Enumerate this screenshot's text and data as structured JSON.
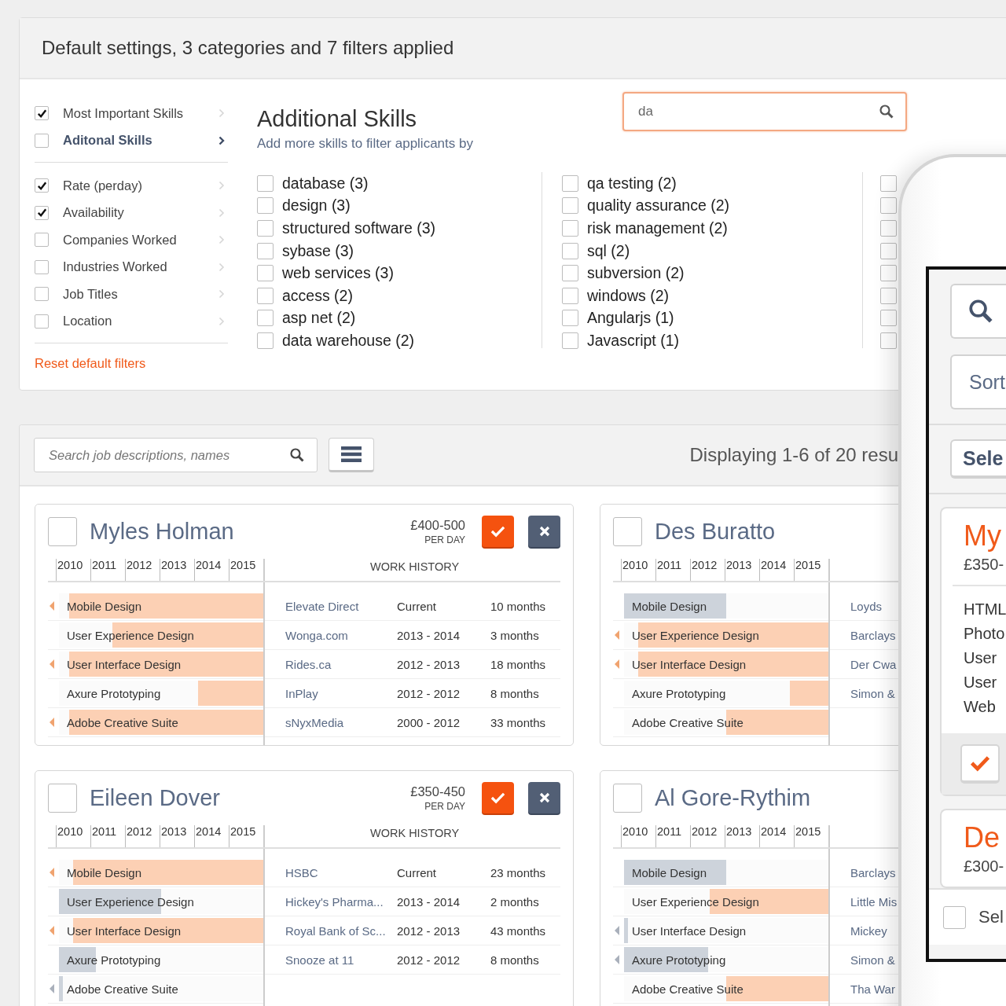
{
  "header": {
    "title": "Default settings, 3 categories and 7 filters applied"
  },
  "filters": {
    "groups": [
      [
        {
          "label": "Most Important Skills",
          "checked": true,
          "selected": false
        },
        {
          "label": "Aditonal Skills",
          "checked": false,
          "selected": true
        }
      ],
      [
        {
          "label": "Rate (perday)",
          "checked": true,
          "selected": false
        },
        {
          "label": "Availability",
          "checked": true,
          "selected": false
        },
        {
          "label": "Companies Worked",
          "checked": false,
          "selected": false
        },
        {
          "label": "Industries Worked",
          "checked": false,
          "selected": false
        },
        {
          "label": "Job Titles",
          "checked": false,
          "selected": false
        },
        {
          "label": "Location",
          "checked": false,
          "selected": false
        }
      ]
    ],
    "reset": "Reset default filters"
  },
  "additional_skills": {
    "title": "Additional Skills",
    "subtitle": "Add more skills to filter applicants by",
    "search": {
      "value": "da"
    },
    "columns": [
      [
        {
          "label": "database (3)",
          "checked": false
        },
        {
          "label": "design (3)",
          "checked": false
        },
        {
          "label": "structured software (3)",
          "checked": false
        },
        {
          "label": "sybase (3)",
          "checked": false
        },
        {
          "label": "web services (3)",
          "checked": false
        },
        {
          "label": "access (2)",
          "checked": false
        },
        {
          "label": "asp net (2)",
          "checked": false
        },
        {
          "label": "data warehouse (2)",
          "checked": false
        }
      ],
      [
        {
          "label": "qa testing (2)",
          "checked": false
        },
        {
          "label": "quality assurance (2)",
          "checked": false
        },
        {
          "label": "risk management (2)",
          "checked": false
        },
        {
          "label": "sql (2)",
          "checked": false
        },
        {
          "label": "subversion (2)",
          "checked": false
        },
        {
          "label": "windows (2)",
          "checked": false
        },
        {
          "label": "Angularjs (1)",
          "checked": false
        },
        {
          "label": "Javascript (1)",
          "checked": false
        }
      ],
      [
        {
          "checked": false
        },
        {
          "checked": false
        },
        {
          "checked": false
        },
        {
          "checked": false
        },
        {
          "checked": false
        },
        {
          "checked": false
        },
        {
          "checked": false
        },
        {
          "checked": false
        }
      ]
    ]
  },
  "results": {
    "search": {
      "placeholder": "Search job descriptions, names"
    },
    "summary": "Displaying 1-6 of 20 resu",
    "candidates": [
      {
        "name": "Myles Holman",
        "selected": false,
        "rate": "£400-500",
        "rate_unit": "PER DAY",
        "years": [
          "2010",
          "2011",
          "2012",
          "2013",
          "2014",
          "2015"
        ],
        "history_heading": "WORK HISTORY",
        "skills": [
          {
            "name": "Mobile Design",
            "kind": "current",
            "level": 0.95,
            "earlier": true
          },
          {
            "name": "User Experience Design",
            "kind": "current",
            "level": 0.74,
            "earlier": false
          },
          {
            "name": "User Interface Design",
            "kind": "current",
            "level": 0.95,
            "earlier": true
          },
          {
            "name": "Axure Prototyping",
            "kind": "current",
            "level": 0.32,
            "earlier": false
          },
          {
            "name": "Adobe Creative Suite",
            "kind": "current",
            "level": 0.95,
            "earlier": true
          }
        ],
        "history": [
          {
            "company": "Elevate Direct",
            "period": "Current",
            "duration": "10 months"
          },
          {
            "company": "Wonga.com",
            "period": "2013 - 2014",
            "duration": "3 months"
          },
          {
            "company": "Rides.ca",
            "period": "2012 - 2013",
            "duration": "18 months"
          },
          {
            "company": "InPlay",
            "period": "2012 - 2012",
            "duration": "8 months"
          },
          {
            "company": "sNyxMedia",
            "period": "2000 - 2012",
            "duration": "33 months"
          }
        ]
      },
      {
        "name": "Des Buratto",
        "selected": false,
        "years": [
          "2010",
          "2011",
          "2012",
          "2013",
          "2014",
          "2015"
        ],
        "skills": [
          {
            "name": "Mobile Design",
            "kind": "past",
            "level": 0.5,
            "earlier": false
          },
          {
            "name": "User Experience Design",
            "kind": "current",
            "level": 0.93,
            "earlier": true
          },
          {
            "name": "User Interface Design",
            "kind": "current",
            "level": 0.93,
            "earlier": true
          },
          {
            "name": "Axure Prototyping",
            "kind": "current",
            "level": 0.19,
            "earlier": false
          },
          {
            "name": "Adobe Creative Suite",
            "kind": "current",
            "level": 0.5,
            "earlier": false
          }
        ],
        "history": [
          {
            "company": "Loyds"
          },
          {
            "company": "Barclays"
          },
          {
            "company": "Der Cwa"
          },
          {
            "company": "Simon &"
          }
        ]
      },
      {
        "name": "Eileen Dover",
        "selected": false,
        "rate": "£350-450",
        "rate_unit": "PER DAY",
        "years": [
          "2010",
          "2011",
          "2012",
          "2013",
          "2014",
          "2015"
        ],
        "history_heading": "WORK HISTORY",
        "skills": [
          {
            "name": "Mobile Design",
            "kind": "current",
            "level": 0.93,
            "earlier": true
          },
          {
            "name": "User Experience Design",
            "kind": "past",
            "level": 0.5,
            "earlier": false
          },
          {
            "name": "User Interface Design",
            "kind": "current",
            "level": 0.93,
            "earlier": true
          },
          {
            "name": "Axure Prototyping",
            "kind": "past",
            "level": 0.18,
            "earlier": false
          },
          {
            "name": "Adobe Creative Suite",
            "kind": "past",
            "level": 0.02,
            "earlier": true
          }
        ],
        "history": [
          {
            "company": "HSBC",
            "period": "Current",
            "duration": "23 months"
          },
          {
            "company": "Hickey's Pharma...",
            "period": "2013 - 2014",
            "duration": "2 months"
          },
          {
            "company": "Royal Bank of Sc...",
            "period": "2012 - 2013",
            "duration": "43 months"
          },
          {
            "company": "Snooze at 11",
            "period": "2012 - 2012",
            "duration": "8 months"
          }
        ]
      },
      {
        "name": "Al Gore-Rythim",
        "selected": false,
        "years": [
          "2010",
          "2011",
          "2012",
          "2013",
          "2014",
          "2015"
        ],
        "skills": [
          {
            "name": "Mobile Design",
            "kind": "past",
            "level": 0.5,
            "earlier": false
          },
          {
            "name": "User Experience Design",
            "kind": "current",
            "level": 0.58,
            "earlier": false
          },
          {
            "name": "User Interface Design",
            "kind": "past",
            "level": 0.02,
            "earlier": true
          },
          {
            "name": "Axure Prototyping",
            "kind": "past",
            "level": 0.41,
            "earlier": true
          },
          {
            "name": "Adobe Creative Suite",
            "kind": "current",
            "level": 0.5,
            "earlier": false
          }
        ],
        "history": [
          {
            "company": "Barclays"
          },
          {
            "company": "Little Mis"
          },
          {
            "company": "Mickey"
          },
          {
            "company": "Simon &"
          },
          {
            "company": "Tha War"
          }
        ]
      }
    ]
  },
  "mobile": {
    "sort": "Sort",
    "select": "Sele",
    "cards": [
      {
        "name": "My",
        "rate": "£350-",
        "skills": [
          "HTML",
          "Photo",
          "User",
          "User",
          "Web"
        ]
      },
      {
        "name": "De",
        "rate": "£300-"
      }
    ],
    "select_row": {
      "label": "Sel",
      "checked": false
    }
  }
}
